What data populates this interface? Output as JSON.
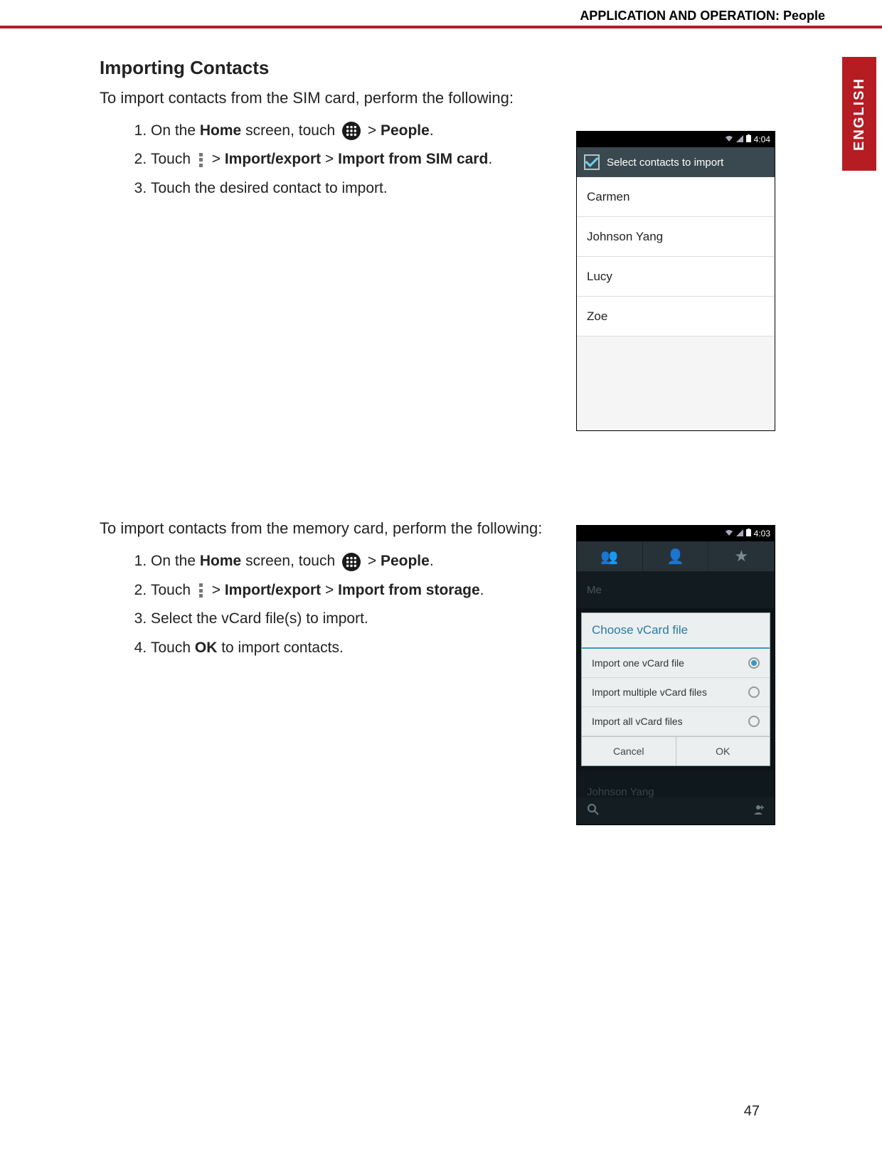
{
  "header": {
    "breadcrumb": "APPLICATION AND OPERATION: People",
    "language": "ENGLISH"
  },
  "section1": {
    "title": "Importing Contacts",
    "intro": "To import contacts from the SIM card, perform the following:",
    "step1_a": "On the ",
    "step1_home": "Home",
    "step1_b": " screen, touch ",
    "step1_c": " > ",
    "step1_people": "People",
    "step1_d": ".",
    "step2_a": "Touch ",
    "step2_b": " > ",
    "step2_ie": "Import/export",
    "step2_c": " > ",
    "step2_sim": "Import from SIM card",
    "step2_d": ".",
    "step3": "Touch the desired contact to import."
  },
  "screenshot1": {
    "time": "4:04",
    "actionbar": "Select contacts to import",
    "contacts": [
      "Carmen",
      "Johnson Yang",
      "Lucy",
      "Zoe"
    ]
  },
  "section2": {
    "intro": "To import contacts from the memory card, perform the following:",
    "step1_a": "On the ",
    "step1_home": "Home",
    "step1_b": " screen, touch ",
    "step1_c": " > ",
    "step1_people": "People",
    "step1_d": ".",
    "step2_a": "Touch ",
    "step2_b": " > ",
    "step2_ie": "Import/export",
    "step2_c": " > ",
    "step2_storage": "Import from storage",
    "step2_d": ".",
    "step3": "Select the vCard file(s) to import.",
    "step4_a": "Touch ",
    "step4_ok": "OK",
    "step4_b": " to import contacts."
  },
  "screenshot2": {
    "time": "4:03",
    "dim_me": "Me",
    "dialog_title": "Choose vCard file",
    "options": [
      {
        "label": "Import one vCard file",
        "selected": true
      },
      {
        "label": "Import multiple vCard files",
        "selected": false
      },
      {
        "label": "Import all vCard files",
        "selected": false
      }
    ],
    "cancel": "Cancel",
    "ok": "OK",
    "dim_johnson": "Johnson Yang"
  },
  "page_number": "47"
}
